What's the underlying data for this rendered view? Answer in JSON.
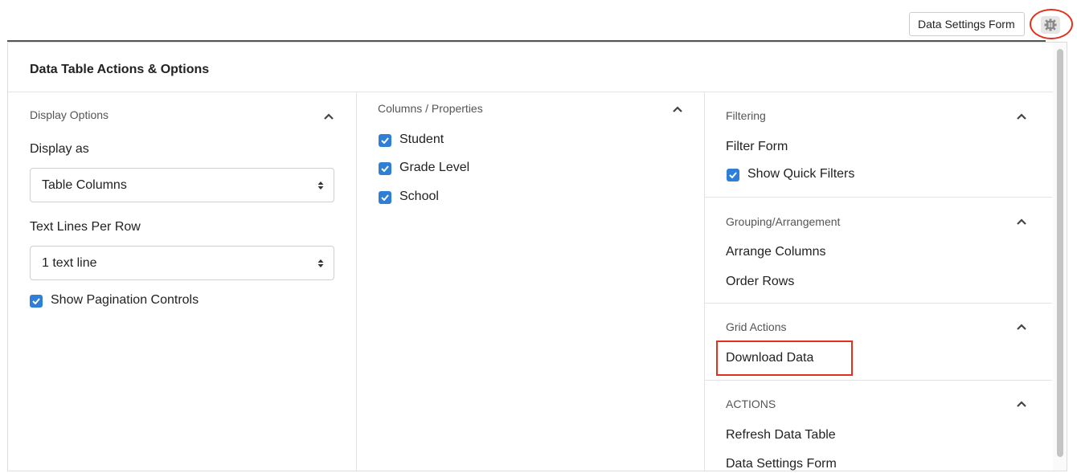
{
  "topbar": {
    "settings_button": "Data Settings Form",
    "gear_icon": "gear-icon"
  },
  "panel": {
    "title": "Data Table Actions & Options"
  },
  "display_options": {
    "section_label": "Display Options",
    "display_as_label": "Display as",
    "display_as_value": "Table Columns",
    "text_lines_label": "Text Lines Per Row",
    "text_lines_value": "1 text line",
    "pagination_label": "Show Pagination Controls",
    "pagination_checked": true
  },
  "columns": {
    "section_label": "Columns / Properties",
    "items": [
      {
        "label": "Student",
        "checked": true
      },
      {
        "label": "Grade Level",
        "checked": true
      },
      {
        "label": "School",
        "checked": true
      }
    ]
  },
  "filtering": {
    "section_label": "Filtering",
    "filter_form": "Filter Form",
    "quick_filters_label": "Show Quick Filters",
    "quick_filters_checked": true
  },
  "grouping": {
    "section_label": "Grouping/Arrangement",
    "arrange_columns": "Arrange Columns",
    "order_rows": "Order Rows"
  },
  "grid_actions": {
    "section_label": "Grid Actions",
    "download_data": "Download Data"
  },
  "actions": {
    "section_label": "ACTIONS",
    "refresh": "Refresh Data Table",
    "settings_form": "Data Settings Form"
  },
  "colors": {
    "checkbox_blue": "#2f7fd6",
    "highlight_red": "#e0311d"
  }
}
